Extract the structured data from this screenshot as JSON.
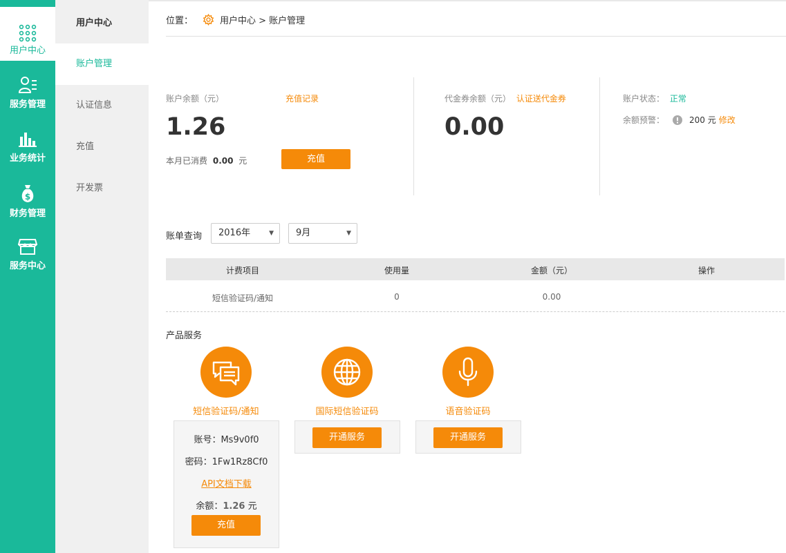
{
  "nav": {
    "items": [
      {
        "label": "用户中心",
        "icon": "grid-icon"
      },
      {
        "label": "服务管理",
        "icon": "user-list-icon"
      },
      {
        "label": "业务统计",
        "icon": "bar-chart-icon"
      },
      {
        "label": "财务管理",
        "icon": "money-bag-icon"
      },
      {
        "label": "服务中心",
        "icon": "store-icon"
      }
    ]
  },
  "subnav": {
    "title": "用户中心",
    "items": [
      "账户管理",
      "认证信息",
      "充值",
      "开发票"
    ]
  },
  "breadcrumb": {
    "prefix": "位置：",
    "path": "用户中心 > 账户管理"
  },
  "account": {
    "balance_label": "账户余额（元）",
    "recharge_record": "充值记录",
    "balance": "1.26",
    "month_used_label": "本月已消费",
    "month_used_value": "0.00",
    "month_used_unit": "元",
    "recharge_button": "充值",
    "voucher_label": "代金券余额（元）",
    "voucher_link": "认证送代金券",
    "voucher_balance": "0.00",
    "status_label": "账户状态：",
    "status_value": "正常",
    "alert_label": "余额预警：",
    "alert_value": "200 元",
    "alert_edit": "修改"
  },
  "bill": {
    "label": "账单查询",
    "year": "2016年",
    "month": "9月",
    "columns": [
      "计费项目",
      "使用量",
      "金额（元）",
      "操作"
    ],
    "rows": [
      [
        "短信验证码/通知",
        "0",
        "0.00",
        ""
      ]
    ]
  },
  "products": {
    "title": "产品服务",
    "items": [
      {
        "name": "短信验证码/通知",
        "icon": "chat-bubbles-icon",
        "account_label": "账号：",
        "account_value": "Ms9v0f0",
        "password_label": "密码：",
        "password_value": "1Fw1Rz8Cf0",
        "api_link": "API文档下载",
        "balance_label": "余额：",
        "balance_value": "1.26",
        "balance_unit": "元",
        "button": "充值"
      },
      {
        "name": "国际短信验证码",
        "icon": "globe-icon",
        "button": "开通服务"
      },
      {
        "name": "语音验证码",
        "icon": "microphone-icon",
        "button": "开通服务"
      }
    ]
  },
  "colors": {
    "accent": "#1ab99a",
    "orange": "#f58a09"
  }
}
